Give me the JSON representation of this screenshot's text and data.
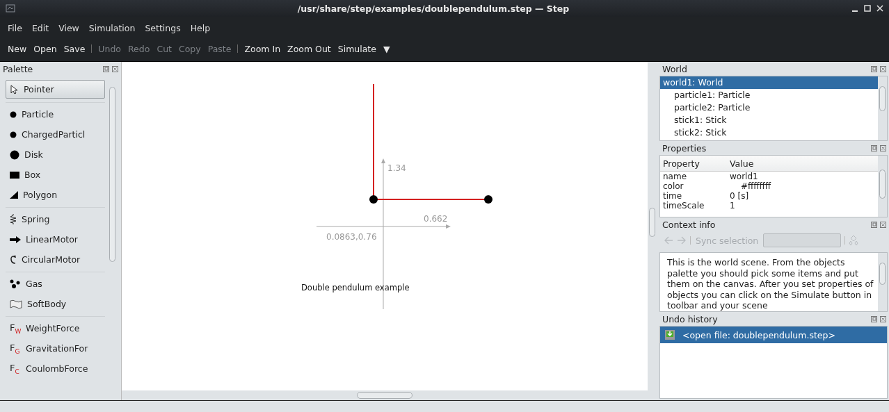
{
  "window": {
    "title": "/usr/share/step/examples/doublependulum.step — Step"
  },
  "menu": [
    {
      "label": "File"
    },
    {
      "label": "Edit"
    },
    {
      "label": "View"
    },
    {
      "label": "Simulation"
    },
    {
      "label": "Settings"
    },
    {
      "label": "Help"
    }
  ],
  "toolbar": [
    {
      "kind": "action",
      "label": "New",
      "disabled": false
    },
    {
      "kind": "action",
      "label": "Open",
      "disabled": false
    },
    {
      "kind": "action",
      "label": "Save",
      "disabled": false
    },
    {
      "kind": "separator"
    },
    {
      "kind": "action",
      "label": "Undo",
      "disabled": true
    },
    {
      "kind": "action",
      "label": "Redo",
      "disabled": true
    },
    {
      "kind": "action",
      "label": "Cut",
      "disabled": true
    },
    {
      "kind": "action",
      "label": "Copy",
      "disabled": true
    },
    {
      "kind": "action",
      "label": "Paste",
      "disabled": true
    },
    {
      "kind": "separator"
    },
    {
      "kind": "action",
      "label": "Zoom In",
      "disabled": false
    },
    {
      "kind": "action",
      "label": "Zoom Out",
      "disabled": false
    },
    {
      "kind": "action",
      "label": "Simulate",
      "disabled": false
    },
    {
      "kind": "action",
      "label": "▼",
      "disabled": false
    }
  ],
  "palette": {
    "title": "Palette",
    "groups": [
      {
        "items": [
          {
            "kind": "pointer",
            "label": "Pointer",
            "selected": true
          }
        ]
      },
      {
        "items": [
          {
            "kind": "particle",
            "label": "Particle",
            "selected": false
          },
          {
            "kind": "particle",
            "label": "ChargedParticl",
            "selected": false
          },
          {
            "kind": "disk",
            "label": "Disk",
            "selected": false
          },
          {
            "kind": "box",
            "label": "Box",
            "selected": false
          },
          {
            "kind": "polygon",
            "label": "Polygon",
            "selected": false
          }
        ]
      },
      {
        "items": [
          {
            "kind": "spring",
            "label": "Spring",
            "selected": false
          },
          {
            "kind": "linear-motor",
            "label": "LinearMotor",
            "selected": false
          },
          {
            "kind": "circular-motor",
            "label": "CircularMotor",
            "selected": false
          }
        ]
      },
      {
        "items": [
          {
            "kind": "gas",
            "label": "Gas",
            "selected": false
          },
          {
            "kind": "softbody",
            "label": "SoftBody",
            "selected": false
          }
        ]
      },
      {
        "items": [
          {
            "kind": "force",
            "symbol": "F",
            "subscript": "W",
            "label": "WeightForce",
            "selected": false
          },
          {
            "kind": "force",
            "symbol": "F",
            "subscript": "G",
            "label": "GravitationFor",
            "selected": false
          },
          {
            "kind": "force",
            "symbol": "F",
            "subscript": "C",
            "label": "CoulombForce",
            "selected": false
          }
        ]
      }
    ]
  },
  "canvas": {
    "caption": "Double pendulum example",
    "y_label": "1.34",
    "x_label": "0.662",
    "origin_label": "0.0863,0.76"
  },
  "world": {
    "title": "World",
    "tree": [
      {
        "label": "world1: World",
        "selected": true,
        "children": [
          {
            "label": "particle1: Particle",
            "selected": false
          },
          {
            "label": "particle2: Particle",
            "selected": false
          },
          {
            "label": "stick1: Stick",
            "selected": false
          },
          {
            "label": "stick2: Stick",
            "selected": false
          }
        ]
      }
    ]
  },
  "properties": {
    "title": "Properties",
    "columns": [
      "Property",
      "Value"
    ],
    "rows": [
      {
        "property": "name",
        "value": "world1",
        "indented": false
      },
      {
        "property": "color",
        "value": "#ffffffff",
        "indented": true
      },
      {
        "property": "time",
        "value": "0 [s]",
        "indented": false
      },
      {
        "property": "timeScale",
        "value": "1",
        "indented": false
      }
    ]
  },
  "context_info": {
    "title": "Context info",
    "sync_label": "Sync selection",
    "text": "This is the world scene. From the objects palette you should pick some items and put them on the canvas. After you set properties of objects you can click on the Simulate button in toolbar and your scene"
  },
  "undo_history": {
    "title": "Undo history",
    "items": [
      {
        "label": "<open file: doublependulum.step>",
        "selected": true
      }
    ]
  }
}
